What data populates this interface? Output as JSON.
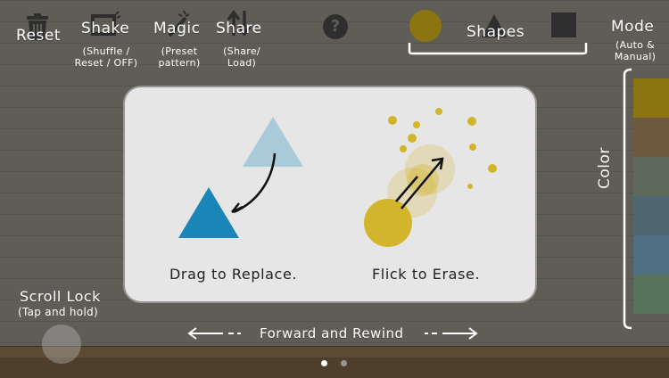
{
  "toolbar": {
    "reset": {
      "label": "Reset",
      "icon": "trash-icon"
    },
    "shake": {
      "label": "Shake",
      "sub1": "(Shuffle /",
      "sub2": "Reset / OFF)",
      "icon": "shake-icon"
    },
    "magic": {
      "label": "Magic",
      "sub1": "(Preset",
      "sub2": "pattern)",
      "icon": "magic-wand-icon"
    },
    "share": {
      "label": "Share",
      "sub1": "(Share/",
      "sub2": "Load)",
      "icon": "share-arrows-icon"
    },
    "help": {
      "label": "?",
      "icon": "help-icon"
    },
    "shapes": {
      "label": "Shapes"
    },
    "mode": {
      "label": "Mode",
      "sub1": "(Auto &",
      "sub2": "Manual)"
    }
  },
  "side": {
    "color_label": "Color"
  },
  "scroll_lock": {
    "label": "Scroll Lock",
    "sub": "(Tap and hold)"
  },
  "bottom": {
    "forward_rewind": "Forward and Rewind"
  },
  "tutorial": {
    "drag_caption": "Drag to Replace.",
    "flick_caption": "Flick to Erase."
  },
  "colors": {
    "background": "#5f5d56",
    "shape_yellow": "#8a7510",
    "triangle_dark": "#1a86b8",
    "triangle_light": "#a9cbd9",
    "circle_yellow": "#d2b52a",
    "palette": [
      "#8a7510",
      "#6e5a3e",
      "#5d6a5a",
      "#4f6570",
      "#4e6f82",
      "#55735a"
    ]
  },
  "pager": {
    "pages": 2,
    "active": 1
  }
}
